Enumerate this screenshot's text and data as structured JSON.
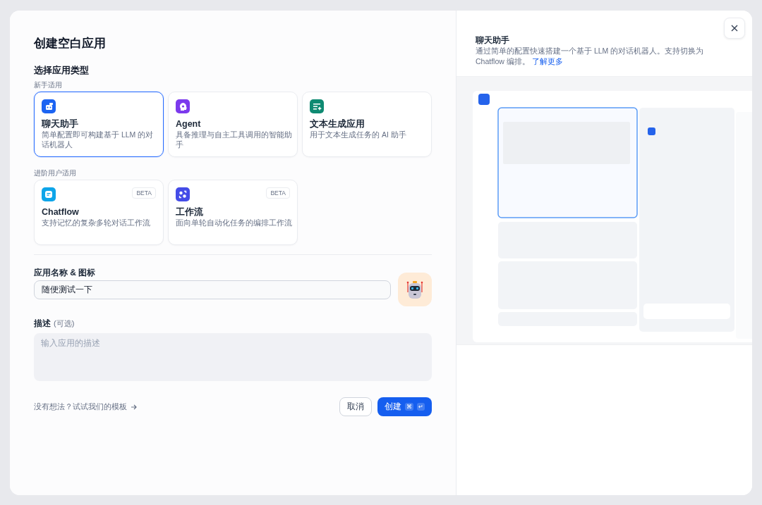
{
  "dialog": {
    "title": "创建空白应用",
    "section_label": "选择应用类型",
    "groups": [
      {
        "label": "新手适用",
        "types": [
          {
            "kind": "chat",
            "name": "聊天助手",
            "description": "简单配置即可构建基于 LLM 的对话机器人",
            "selected": true
          },
          {
            "kind": "agent",
            "name": "Agent",
            "description": "具备推理与自主工具调用的智能助手",
            "selected": false
          },
          {
            "kind": "text",
            "name": "文本生成应用",
            "description": "用于文本生成任务的 AI 助手",
            "selected": false
          }
        ]
      },
      {
        "label": "进阶用户适用",
        "types": [
          {
            "kind": "chatflow",
            "name": "Chatflow",
            "description": "支持记忆的复杂多轮对话工作流",
            "badge": "BETA",
            "selected": false
          },
          {
            "kind": "workflow",
            "name": "工作流",
            "description": "面向单轮自动化任务的编排工作流",
            "badge": "BETA",
            "selected": false
          }
        ]
      }
    ],
    "name_label": "应用名称 & 图标",
    "name_value": "随便测试一下",
    "description_label": "描述",
    "description_optional": "(可选)",
    "description_placeholder": "输入应用的描述",
    "template_link": "没有想法？试试我们的模板",
    "cancel": "取消",
    "create": "创建",
    "create_keys": [
      "⌘",
      "↵"
    ]
  },
  "info": {
    "title": "聊天助手",
    "description": "通过简单的配置快速搭建一个基于 LLM 的对话机器人。支持切换为 Chatflow 编排。",
    "link": "了解更多"
  }
}
